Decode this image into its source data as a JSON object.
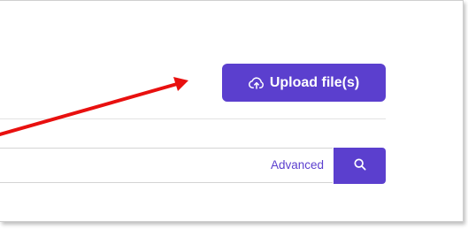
{
  "upload": {
    "label": "Upload file(s)",
    "icon": "cloud-upload-icon"
  },
  "search": {
    "value": "",
    "placeholder": "",
    "advanced_label": "Advanced",
    "button_icon": "search-icon"
  },
  "annotation": {
    "arrow_color": "#e8100f"
  },
  "colors": {
    "accent": "#5b3fce",
    "border": "#d4d4d4"
  }
}
